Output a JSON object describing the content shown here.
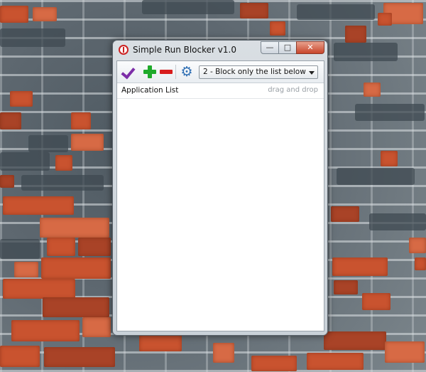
{
  "window": {
    "title": "Simple Run Blocker v1.0",
    "controls": {
      "minimize": "—",
      "maximize": "□",
      "close": "✕"
    }
  },
  "toolbar": {
    "icons": [
      "checkmark-icon",
      "add-icon",
      "remove-icon",
      "gear-icon"
    ],
    "gear_glyph": "⚙",
    "mode_select": {
      "selected": "2 - Block only the list below"
    }
  },
  "list": {
    "title": "Application List",
    "hint": "drag and drop",
    "items": []
  },
  "colors": {
    "accent_check": "#7d2ea8",
    "add": "#1eaa2a",
    "remove": "#d81c1c",
    "gear": "#2f6fb4",
    "brick": "#c9532f"
  }
}
